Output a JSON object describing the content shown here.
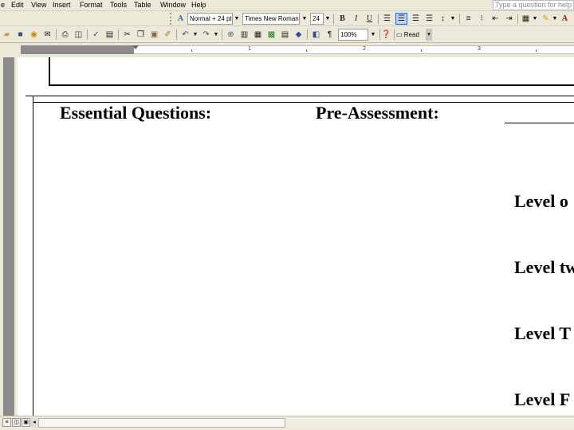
{
  "menu": {
    "items": [
      "e",
      "Edit",
      "View",
      "Insert",
      "Format",
      "Tools",
      "Table",
      "Window",
      "Help"
    ],
    "help_placeholder": "Type a question for help"
  },
  "formatting_toolbar": {
    "style_value": "Normal + 24 pt",
    "font_value": "Times New Roman",
    "size_value": "24",
    "bold": "B",
    "italic": "I",
    "underline": "U"
  },
  "standard_toolbar": {
    "zoom_value": "100%",
    "paragraph_mark": "¶",
    "read_label": "Read"
  },
  "ruler": {
    "numbers": [
      "1",
      "2",
      "3"
    ]
  },
  "document": {
    "essential_questions": "Essential Questions:",
    "pre_assessment": "Pre-Assessment:",
    "level_one": "Level o",
    "level_two": "Level tw",
    "level_three": "Level T",
    "level_four": "Level F"
  },
  "colors": {
    "chrome": "#ece9d8",
    "ruler_gray": "#8c8c8c",
    "page": "#ffffff",
    "active_button": "#c1d2ee"
  }
}
